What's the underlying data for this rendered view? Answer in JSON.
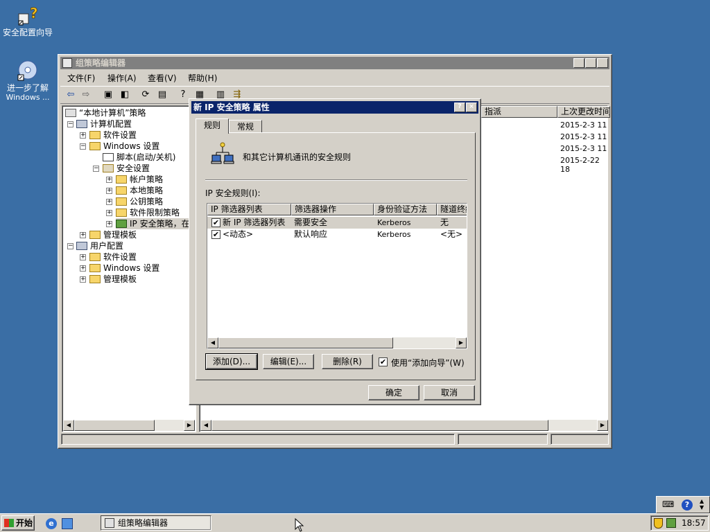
{
  "desktop": {
    "icons": [
      {
        "label": "安全配置向导"
      },
      {
        "label1": "进一步了解",
        "label2": "Windows ..."
      }
    ]
  },
  "gpe": {
    "title": "组策略编辑器",
    "menus": [
      "文件(F)",
      "操作(A)",
      "查看(V)",
      "帮助(H)"
    ],
    "tree": {
      "root": "“本地计算机”策略",
      "computer_config": "计算机配置",
      "software_settings": "软件设置",
      "windows_settings": "Windows 设置",
      "scripts": "脚本(启动/关机)",
      "security_settings": "安全设置",
      "account_policy": "帐户策略",
      "local_policy": "本地策略",
      "public_key_policy": "公钥策略",
      "software_restriction": "软件限制策略",
      "ip_security": "IP 安全策略，在",
      "admin_templates": "管理模板",
      "user_config": "用户配置",
      "u_software": "软件设置",
      "u_windows": "Windows 设置",
      "u_admin": "管理模板"
    },
    "right": {
      "col_assigned": "指派",
      "col_modified": "上次更改时间",
      "dates": [
        "2015-2-3 11",
        "2015-2-3 11",
        "2015-2-3 11",
        "2015-2-22 18"
      ]
    }
  },
  "dialog": {
    "title": "新 IP 安全策略 属性",
    "help_btn": "?",
    "close_btn": "×",
    "tabs": [
      "规则",
      "常规"
    ],
    "description": "和其它计算机通讯的安全规则",
    "rules_label": "IP 安全规则(I):",
    "columns": [
      "IP 筛选器列表",
      "筛选器操作",
      "身份验证方法",
      "隧道终结"
    ],
    "rows": [
      {
        "checked": "✔",
        "filter": "新 IP 筛选器列表",
        "action": "需要安全",
        "auth": "Kerberos",
        "tunnel": "无"
      },
      {
        "checked": "✔",
        "filter": "<动态>",
        "action": "默认响应",
        "auth": "Kerberos",
        "tunnel": "<无>"
      }
    ],
    "add_btn": "添加(D)...",
    "edit_btn": "编辑(E)...",
    "remove_btn": "删除(R)",
    "wizard_check": "✔",
    "wizard_label": "使用“添加向导”(W)",
    "ok_btn": "确定",
    "cancel_btn": "取消"
  },
  "taskbar": {
    "start": "开始",
    "task": "组策略编辑器",
    "time": "18:57"
  }
}
